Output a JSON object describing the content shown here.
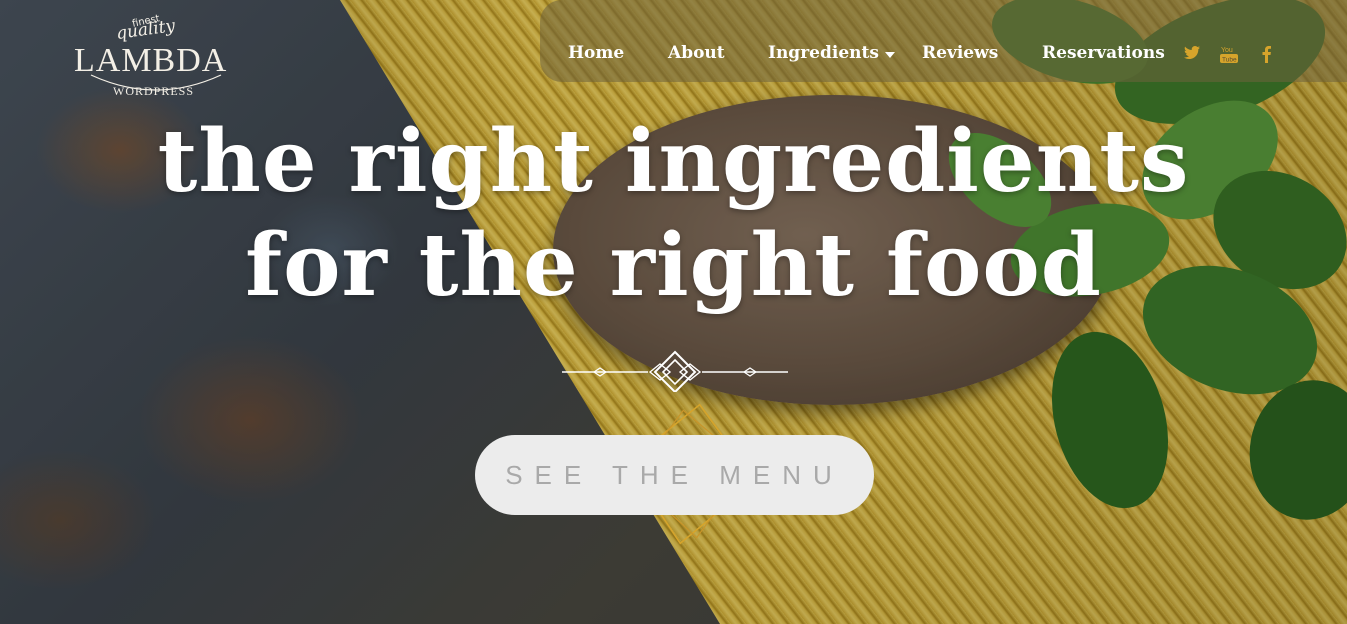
{
  "logo": {
    "tagline_small": "finest",
    "tagline": "quality",
    "name": "LAMBDA",
    "subtitle": "WORDPRESS"
  },
  "nav": {
    "items": [
      {
        "label": "Home"
      },
      {
        "label": "About"
      },
      {
        "label": "Ingredients",
        "has_dropdown": true
      },
      {
        "label": "Reviews"
      },
      {
        "label": "Reservations"
      }
    ],
    "social": [
      {
        "icon": "twitter-icon",
        "glyph": "🐦"
      },
      {
        "icon": "youtube-icon",
        "glyph": "You"
      },
      {
        "icon": "facebook-icon",
        "glyph": "f"
      }
    ]
  },
  "hero": {
    "headline_line1": "the right ingredients",
    "headline_line2": "for the right food",
    "cta_label": "SEE THE MENU"
  },
  "colors": {
    "accent": "#d6a42b",
    "nav_bg": "#6e623c",
    "cta_bg": "#ececec",
    "cta_text": "#a9a9a9"
  }
}
